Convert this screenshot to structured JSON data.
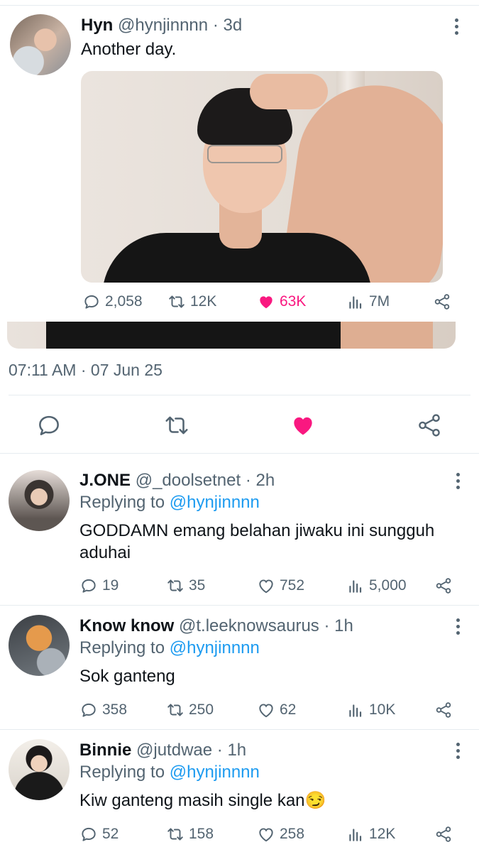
{
  "main_tweet": {
    "name": "Hyn",
    "handle": "@hynjinnnn",
    "age": "· 3d",
    "text": "Another day.",
    "stats": {
      "replies": "2,058",
      "retweets": "12K",
      "likes": "63K",
      "views": "7M"
    },
    "timestamp": "07:11 AM · 07 Jun 25"
  },
  "colors": {
    "like_pink": "#f91880",
    "mention_blue": "#1d9bf0",
    "secondary_gray": "#536471"
  },
  "replies": [
    {
      "name": "J.ONE",
      "handle": "@_doolsetnet",
      "age": "· 2h",
      "replying_prefix": "Replying to",
      "replying_to": "@hynjinnnn",
      "text": "GODDAMN emang belahan jiwaku ini sungguh aduhai",
      "stats": {
        "replies": "19",
        "retweets": "35",
        "likes": "752",
        "views": "5,000"
      }
    },
    {
      "name": "Know know",
      "handle": "@t.leeknowsaurus",
      "age": "· 1h",
      "replying_prefix": "Replying to",
      "replying_to": "@hynjinnnn",
      "text": "Sok ganteng",
      "stats": {
        "replies": "358",
        "retweets": "250",
        "likes": "62",
        "views": "10K"
      }
    },
    {
      "name": "Binnie",
      "handle": "@jutdwae",
      "age": "· 1h",
      "replying_prefix": "Replying to",
      "replying_to": "@hynjinnnn",
      "text": "Kiw ganteng masih single kan😏",
      "stats": {
        "replies": "52",
        "retweets": "158",
        "likes": "258",
        "views": "12K"
      }
    }
  ]
}
